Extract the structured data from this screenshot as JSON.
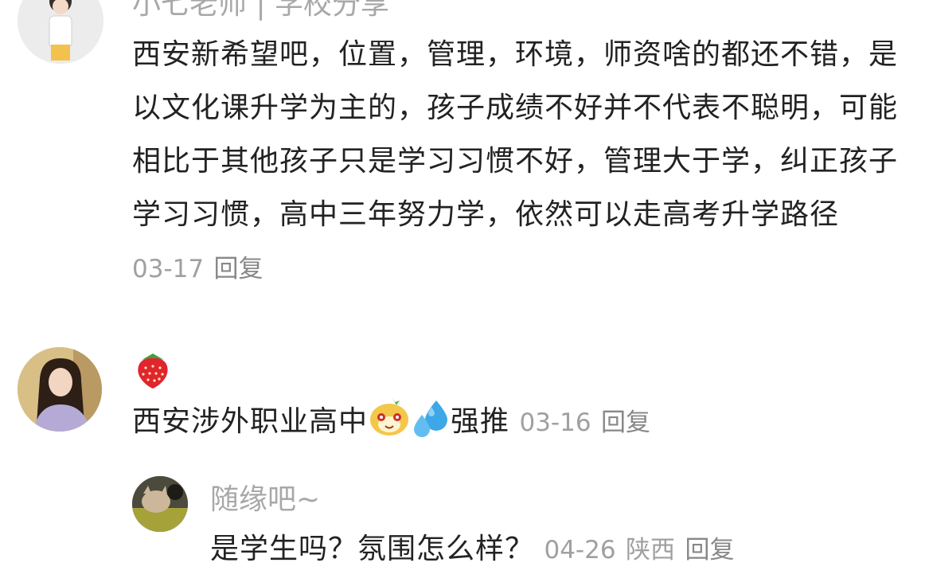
{
  "comments": [
    {
      "username": "小七老师 | 学校分享",
      "text": "西安新希望吧，位置，管理，环境，师资啥的都还不错，是以文化课升学为主的，孩子成绩不好并不代表不聪明，可能相比于其他孩子只是学习习惯不好，管理大于学，纠正孩子学习习惯，高中三年努力学，依然可以走高考升学路径",
      "date": "03-17",
      "reply_label": "回复"
    },
    {
      "username_emoji": "strawberry-icon",
      "text_before": "西安涉外职业高中",
      "text_after": "强推",
      "emojis": [
        "cute-face-emoji-icon",
        "sweat-droplets-icon"
      ],
      "date": "03-16",
      "reply_label": "回复",
      "replies": [
        {
          "username": "随缘吧~",
          "text": "是学生吗？氛围怎么样？",
          "date": "04-26",
          "location": "陕西",
          "reply_label": "回复"
        }
      ]
    }
  ]
}
